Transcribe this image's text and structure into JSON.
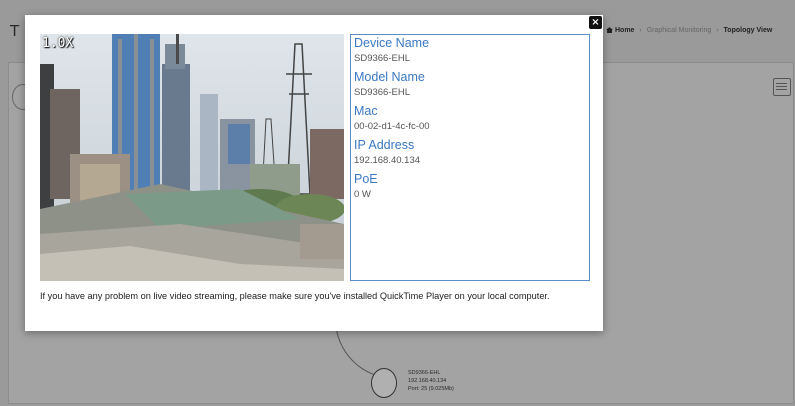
{
  "background": {
    "page_title": "T",
    "breadcrumb": {
      "home": "Home",
      "middle": "Graphical Monitoring",
      "current": "Topology View"
    },
    "device_label": {
      "name": "SD9366-EHL",
      "ip": "192.168.40.134",
      "port": "Port: 25 (9.025Mb)"
    }
  },
  "modal": {
    "close_label": "×",
    "video": {
      "zoom": "1.0X"
    },
    "info": {
      "device_name_label": "Device Name",
      "device_name": "SD9366-EHL",
      "model_name_label": "Model Name",
      "model_name": "SD9366-EHL",
      "mac_label": "Mac",
      "mac": "00-02-d1-4c-fc-00",
      "ip_label": "IP Address",
      "ip": "192.168.40.134",
      "poe_label": "PoE",
      "poe": "0 W"
    },
    "note": "If you have any problem on live video streaming, please make sure you've installed QuickTime Player on your local computer."
  },
  "colors": {
    "accent": "#3a78c2",
    "overlay": "#9a9a9a"
  }
}
